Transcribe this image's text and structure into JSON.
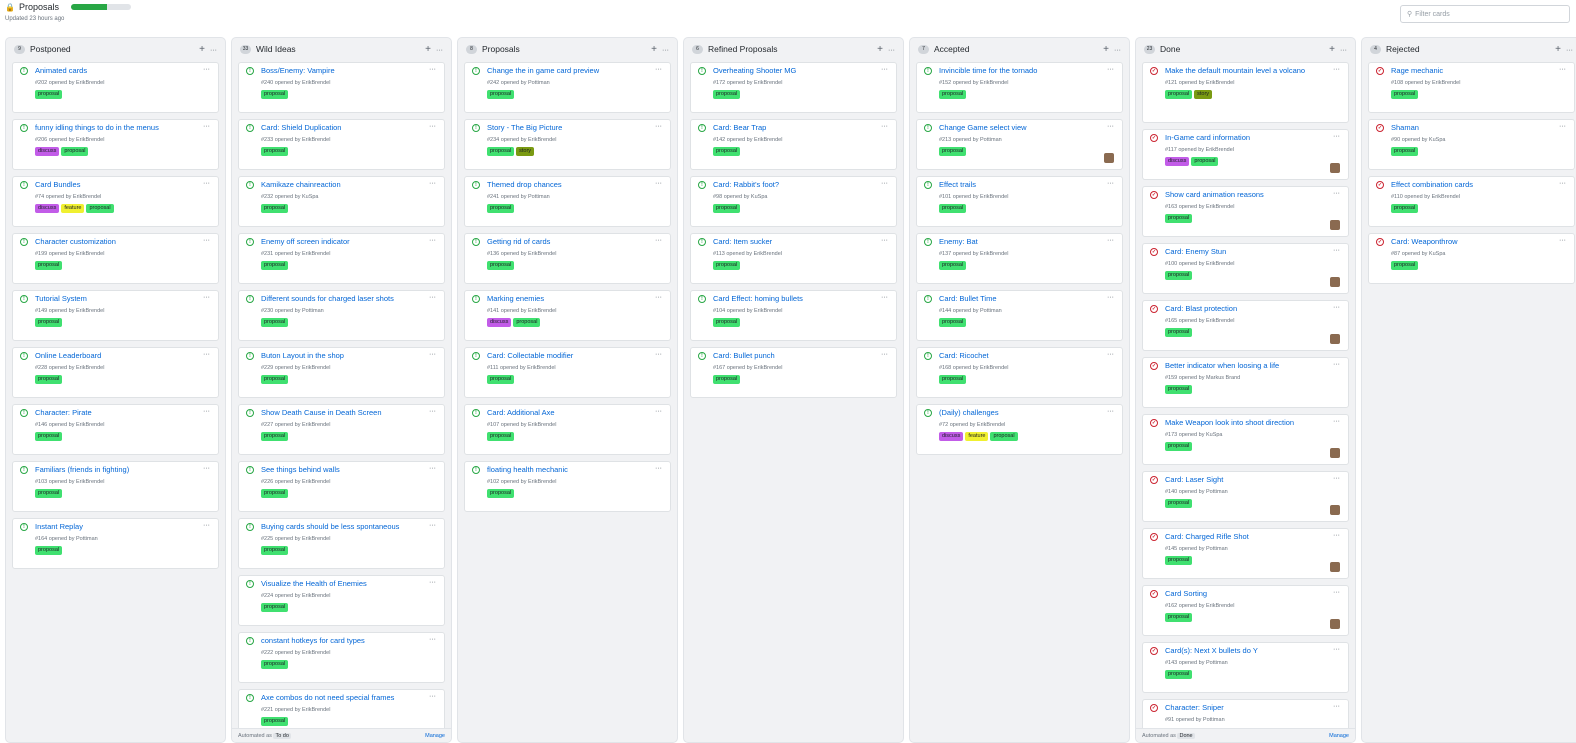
{
  "project": {
    "title": "Proposals",
    "progress_fraction": 0.6,
    "updated": "Updated 23 hours ago",
    "lock_icon": "lock-icon"
  },
  "filter": {
    "placeholder": "Filter cards",
    "icon": "search-icon"
  },
  "colors": {
    "proposal": "#40e070",
    "discuss": "#c25ce8",
    "feature": "#f0f030",
    "story": "#7a9a12",
    "open": "#28a745",
    "closed": "#cb2431",
    "link": "#0366d6"
  },
  "columns": [
    {
      "name": "Postponed",
      "count": "9",
      "cards": [
        {
          "title": "Animated cards",
          "meta": "#202 opened by ErikBrendel",
          "labels": [
            "proposal"
          ],
          "state": "open"
        },
        {
          "title": "funny idling things to do in the menus",
          "meta": "#206 opened by ErikBrendel",
          "labels": [
            "discuss",
            "proposal"
          ],
          "state": "open"
        },
        {
          "title": "Card Bundles",
          "meta": "#74 opened by ErikBrendel",
          "labels": [
            "discuss",
            "feature",
            "proposal"
          ],
          "state": "open"
        },
        {
          "title": "Character customization",
          "meta": "#199 opened by ErikBrendel",
          "labels": [
            "proposal"
          ],
          "state": "open"
        },
        {
          "title": "Tutorial System",
          "meta": "#149 opened by ErikBrendel",
          "labels": [
            "proposal"
          ],
          "state": "open"
        },
        {
          "title": "Online Leaderboard",
          "meta": "#228 opened by ErikBrendel",
          "labels": [
            "proposal"
          ],
          "state": "open"
        },
        {
          "title": "Character: Pirate",
          "meta": "#146 opened by ErikBrendel",
          "labels": [
            "proposal"
          ],
          "state": "open"
        },
        {
          "title": "Familiars (friends in fighting)",
          "meta": "#103 opened by ErikBrendel",
          "labels": [
            "proposal"
          ],
          "state": "open"
        },
        {
          "title": "Instant Replay",
          "meta": "#164 opened by Pottiman",
          "labels": [
            "proposal"
          ],
          "state": "open"
        }
      ]
    },
    {
      "name": "Wild Ideas",
      "count": "33",
      "footer": {
        "auto": "Automated as",
        "tag": "To do",
        "manage": "Manage"
      },
      "cards": [
        {
          "title": "Boss/Enemy: Vampire",
          "meta": "#240 opened by ErikBrendel",
          "labels": [
            "proposal"
          ],
          "state": "open"
        },
        {
          "title": "Card: Shield Duplication",
          "meta": "#233 opened by ErikBrendel",
          "labels": [
            "proposal"
          ],
          "state": "open"
        },
        {
          "title": "Kamikaze chainreaction",
          "meta": "#232 opened by KuSpa",
          "labels": [
            "proposal"
          ],
          "state": "open"
        },
        {
          "title": "Enemy off screen indicator",
          "meta": "#231 opened by ErikBrendel",
          "labels": [
            "proposal"
          ],
          "state": "open"
        },
        {
          "title": "Different sounds for charged laser shots",
          "meta": "#230 opened by Pottiman",
          "labels": [
            "proposal"
          ],
          "state": "open"
        },
        {
          "title": "Buton Layout in the shop",
          "meta": "#229 opened by ErikBrendel",
          "labels": [
            "proposal"
          ],
          "state": "open"
        },
        {
          "title": "Show Death Cause in Death Screen",
          "meta": "#227 opened by ErikBrendel",
          "labels": [
            "proposal"
          ],
          "state": "open"
        },
        {
          "title": "See things behind walls",
          "meta": "#226 opened by ErikBrendel",
          "labels": [
            "proposal"
          ],
          "state": "open"
        },
        {
          "title": "Buying cards should be less spontaneous",
          "meta": "#225 opened by ErikBrendel",
          "labels": [
            "proposal"
          ],
          "state": "open"
        },
        {
          "title": "Visualize the Health of Enemies",
          "meta": "#224 opened by ErikBrendel",
          "labels": [
            "proposal"
          ],
          "state": "open"
        },
        {
          "title": "constant hotkeys for card types",
          "meta": "#222 opened by ErikBrendel",
          "labels": [
            "proposal"
          ],
          "state": "open"
        },
        {
          "title": "Axe combos do not need special frames",
          "meta": "#221 opened by ErikBrendel",
          "labels": [
            "proposal"
          ],
          "state": "open"
        }
      ]
    },
    {
      "name": "Proposals",
      "count": "8",
      "cards": [
        {
          "title": "Change the in game card preview",
          "meta": "#242 opened by Pottiman",
          "labels": [
            "proposal"
          ],
          "state": "open"
        },
        {
          "title": "Story - The Big Picture",
          "meta": "#234 opened by ErikBrendel",
          "labels": [
            "proposal",
            "story"
          ],
          "state": "open"
        },
        {
          "title": "Themed drop chances",
          "meta": "#241 opened by Pottiman",
          "labels": [
            "proposal"
          ],
          "state": "open"
        },
        {
          "title": "Getting rid of cards",
          "meta": "#136 opened by ErikBrendel",
          "labels": [
            "proposal"
          ],
          "state": "open"
        },
        {
          "title": "Marking enemies",
          "meta": "#141 opened by ErikBrendel",
          "labels": [
            "discuss",
            "proposal"
          ],
          "state": "open"
        },
        {
          "title": "Card: Collectable modifier",
          "meta": "#111 opened by ErikBrendel",
          "labels": [
            "proposal"
          ],
          "state": "open"
        },
        {
          "title": "Card: Additional Axe",
          "meta": "#107 opened by ErikBrendel",
          "labels": [
            "proposal"
          ],
          "state": "open"
        },
        {
          "title": "floating health mechanic",
          "meta": "#102 opened by ErikBrendel",
          "labels": [
            "proposal"
          ],
          "state": "open"
        }
      ]
    },
    {
      "name": "Refined Proposals",
      "count": "6",
      "cards": [
        {
          "title": "Overheating Shooter MG",
          "meta": "#172 opened by ErikBrendel",
          "labels": [
            "proposal"
          ],
          "state": "open"
        },
        {
          "title": "Card: Bear Trap",
          "meta": "#142 opened by ErikBrendel",
          "labels": [
            "proposal"
          ],
          "state": "open"
        },
        {
          "title": "Card: Rabbit's foot?",
          "meta": "#98 opened by KuSpa",
          "labels": [
            "proposal"
          ],
          "state": "open"
        },
        {
          "title": "Card: Item sucker",
          "meta": "#113 opened by ErikBrendel",
          "labels": [
            "proposal"
          ],
          "state": "open"
        },
        {
          "title": "Card Effect: homing bullets",
          "meta": "#104 opened by ErikBrendel",
          "labels": [
            "proposal"
          ],
          "state": "open"
        },
        {
          "title": "Card: Bullet punch",
          "meta": "#167 opened by ErikBrendel",
          "labels": [
            "proposal"
          ],
          "state": "open"
        }
      ]
    },
    {
      "name": "Accepted",
      "count": "7",
      "cards": [
        {
          "title": "Invincible time for the tornado",
          "meta": "#152 opened by ErikBrendel",
          "labels": [
            "proposal"
          ],
          "state": "open"
        },
        {
          "title": "Change Game select view",
          "meta": "#213 opened by Pottiman",
          "labels": [
            "proposal"
          ],
          "state": "open",
          "avatar": true
        },
        {
          "title": "Effect trails",
          "meta": "#101 opened by ErikBrendel",
          "labels": [
            "proposal"
          ],
          "state": "open"
        },
        {
          "title": "Enemy: Bat",
          "meta": "#137 opened by ErikBrendel",
          "labels": [
            "proposal"
          ],
          "state": "open"
        },
        {
          "title": "Card: Bullet Time",
          "meta": "#144 opened by Pottiman",
          "labels": [
            "proposal"
          ],
          "state": "open"
        },
        {
          "title": "Card: Ricochet",
          "meta": "#168 opened by ErikBrendel",
          "labels": [
            "proposal"
          ],
          "state": "open"
        },
        {
          "title": "(Daily) challenges",
          "meta": "#72 opened by ErikBrendel",
          "labels": [
            "discuss",
            "feature",
            "proposal"
          ],
          "state": "open"
        }
      ]
    },
    {
      "name": "Done",
      "count": "23",
      "footer": {
        "auto": "Automated as",
        "tag": "Done",
        "manage": "Manage"
      },
      "cards": [
        {
          "title": "Make the default mountain level a volcano",
          "meta": "#121 opened by ErikBrendel",
          "labels": [
            "proposal",
            "story"
          ],
          "state": "closed"
        },
        {
          "title": "In-Game card information",
          "meta": "#117 opened by ErikBrendel",
          "labels": [
            "discuss",
            "proposal"
          ],
          "state": "closed",
          "avatar": true
        },
        {
          "title": "Show card animation reasons",
          "meta": "#163 opened by ErikBrendel",
          "labels": [
            "proposal"
          ],
          "state": "closed",
          "avatar": true
        },
        {
          "title": "Card: Enemy Stun",
          "meta": "#100 opened by ErikBrendel",
          "labels": [
            "proposal"
          ],
          "state": "closed",
          "avatar": true
        },
        {
          "title": "Card: Blast protection",
          "meta": "#165 opened by ErikBrendel",
          "labels": [
            "proposal"
          ],
          "state": "closed",
          "avatar": true
        },
        {
          "title": "Better indicator when loosing a life",
          "meta": "#159 opened by Markus Brand",
          "labels": [
            "proposal"
          ],
          "state": "closed"
        },
        {
          "title": "Make Weapon look into shoot direction",
          "meta": "#173 opened by KuSpa",
          "labels": [
            "proposal"
          ],
          "state": "closed",
          "avatar": true
        },
        {
          "title": "Card: Laser Sight",
          "meta": "#140 opened by Pottiman",
          "labels": [
            "proposal"
          ],
          "state": "closed",
          "avatar": true
        },
        {
          "title": "Card: Charged Rifle Shot",
          "meta": "#145 opened by Pottiman",
          "labels": [
            "proposal"
          ],
          "state": "closed",
          "avatar": true
        },
        {
          "title": "Card Sorting",
          "meta": "#162 opened by ErikBrendel",
          "labels": [
            "proposal"
          ],
          "state": "closed",
          "avatar": true
        },
        {
          "title": "Card(s): Next X bullets do Y",
          "meta": "#143 opened by Pottiman",
          "labels": [
            "proposal"
          ],
          "state": "closed"
        },
        {
          "title": "Character: Sniper",
          "meta": "#91 opened by Pottiman",
          "labels": [],
          "state": "closed"
        }
      ]
    },
    {
      "name": "Rejected",
      "count": "4",
      "cards": [
        {
          "title": "Rage mechanic",
          "meta": "#108 opened by ErikBrendel",
          "labels": [
            "proposal"
          ],
          "state": "closed"
        },
        {
          "title": "Shaman",
          "meta": "#90 opened by KuSpa",
          "labels": [
            "proposal"
          ],
          "state": "closed"
        },
        {
          "title": "Effect combination cards",
          "meta": "#110 opened by ErikBrendel",
          "labels": [
            "proposal"
          ],
          "state": "closed"
        },
        {
          "title": "Card: Weaponthrow",
          "meta": "#87 opened by KuSpa",
          "labels": [
            "proposal"
          ],
          "state": "closed"
        }
      ]
    }
  ]
}
